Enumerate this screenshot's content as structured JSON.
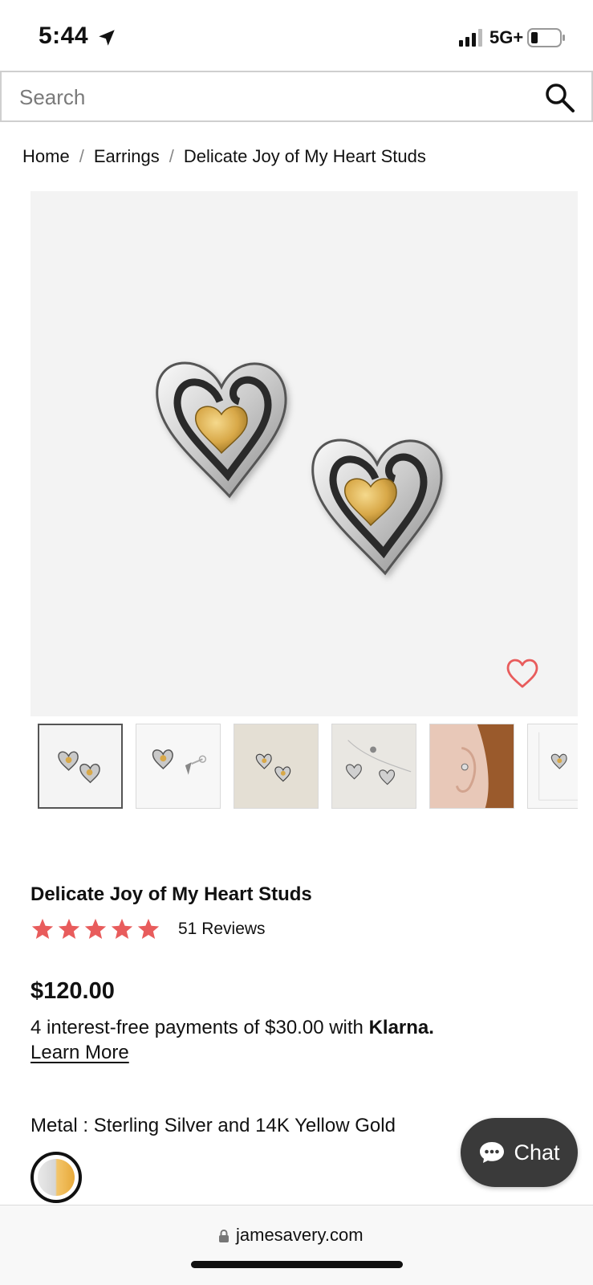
{
  "status_bar": {
    "time": "5:44",
    "network": "5G+",
    "location_icon": "location-arrow-icon",
    "signal_icon": "cellular-signal-icon",
    "battery_icon": "battery-icon"
  },
  "search": {
    "placeholder": "Search",
    "icon": "search-icon"
  },
  "breadcrumb": {
    "items": [
      "Home",
      "Earrings",
      "Delicate Joy of My Heart Studs"
    ],
    "separator": "/"
  },
  "gallery": {
    "wishlist_icon": "heart-outline-icon",
    "thumbnail_count": 6,
    "selected_index": 0
  },
  "product": {
    "title": "Delicate Joy of My Heart Studs",
    "rating": 5,
    "review_count_label": "51 Reviews",
    "price": "$120.00",
    "klarna_text": "4 interest-free payments of $30.00 with",
    "klarna_brand": "Klarna.",
    "learn_more": "Learn More",
    "metal_label": "Metal : Sterling Silver and 14K Yellow Gold"
  },
  "chat": {
    "label": "Chat",
    "icon": "chat-bubble-icon"
  },
  "url_bar": {
    "domain": "jamesavery.com",
    "lock_icon": "lock-icon"
  },
  "colors": {
    "star": "#e85c5c",
    "wishlist": "#e85c5c",
    "chat_bg": "#3a3a3a",
    "gold": "#d9a441"
  }
}
